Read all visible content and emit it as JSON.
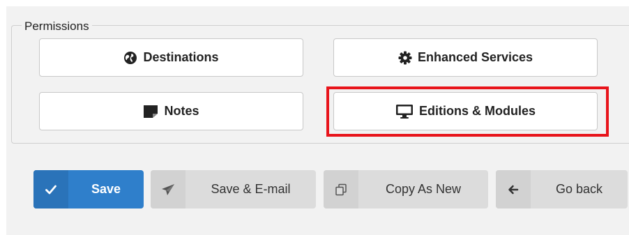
{
  "permissions": {
    "legend": "Permissions",
    "buttons": {
      "destinations": "Destinations",
      "enhanced_services": "Enhanced Services",
      "notes": "Notes",
      "editions_modules": "Editions & Modules"
    }
  },
  "actions": {
    "save": "Save",
    "save_email": "Save & E-mail",
    "copy_as_new": "Copy As New",
    "go_back": "Go back"
  },
  "colors": {
    "primary": "#2f7fcb",
    "highlight": "#e8141b",
    "secondary_button": "#dcdcdc"
  }
}
